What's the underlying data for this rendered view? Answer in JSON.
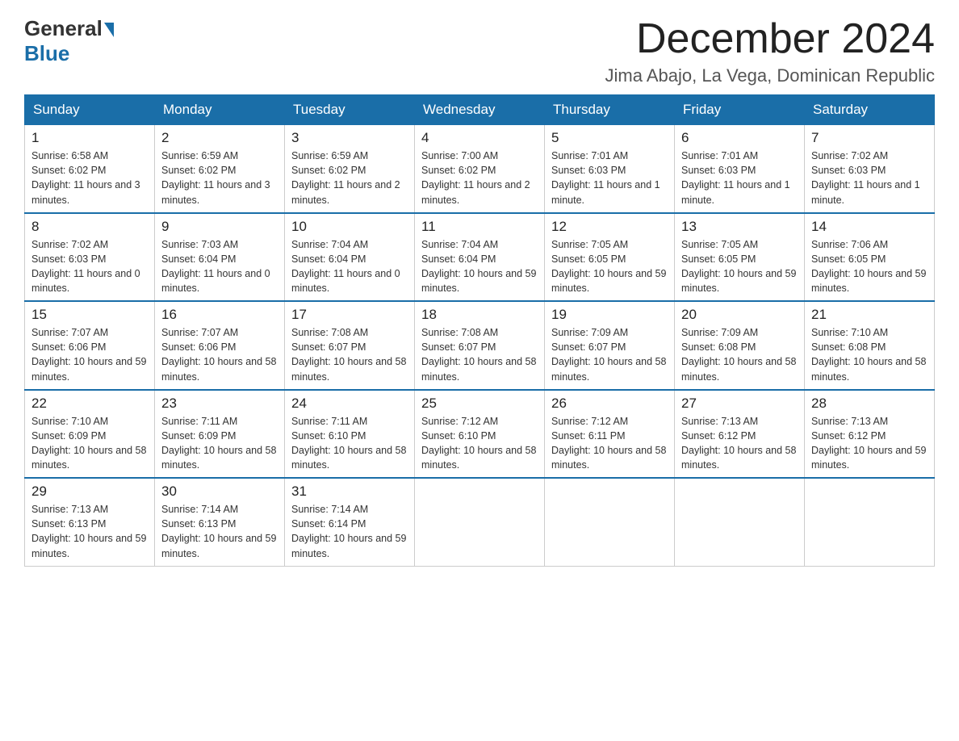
{
  "header": {
    "logo_general": "General",
    "logo_blue": "Blue",
    "month_title": "December 2024",
    "location": "Jima Abajo, La Vega, Dominican Republic"
  },
  "weekdays": [
    "Sunday",
    "Monday",
    "Tuesday",
    "Wednesday",
    "Thursday",
    "Friday",
    "Saturday"
  ],
  "weeks": [
    [
      {
        "day": "1",
        "sunrise": "6:58 AM",
        "sunset": "6:02 PM",
        "daylight": "11 hours and 3 minutes."
      },
      {
        "day": "2",
        "sunrise": "6:59 AM",
        "sunset": "6:02 PM",
        "daylight": "11 hours and 3 minutes."
      },
      {
        "day": "3",
        "sunrise": "6:59 AM",
        "sunset": "6:02 PM",
        "daylight": "11 hours and 2 minutes."
      },
      {
        "day": "4",
        "sunrise": "7:00 AM",
        "sunset": "6:02 PM",
        "daylight": "11 hours and 2 minutes."
      },
      {
        "day": "5",
        "sunrise": "7:01 AM",
        "sunset": "6:03 PM",
        "daylight": "11 hours and 1 minute."
      },
      {
        "day": "6",
        "sunrise": "7:01 AM",
        "sunset": "6:03 PM",
        "daylight": "11 hours and 1 minute."
      },
      {
        "day": "7",
        "sunrise": "7:02 AM",
        "sunset": "6:03 PM",
        "daylight": "11 hours and 1 minute."
      }
    ],
    [
      {
        "day": "8",
        "sunrise": "7:02 AM",
        "sunset": "6:03 PM",
        "daylight": "11 hours and 0 minutes."
      },
      {
        "day": "9",
        "sunrise": "7:03 AM",
        "sunset": "6:04 PM",
        "daylight": "11 hours and 0 minutes."
      },
      {
        "day": "10",
        "sunrise": "7:04 AM",
        "sunset": "6:04 PM",
        "daylight": "11 hours and 0 minutes."
      },
      {
        "day": "11",
        "sunrise": "7:04 AM",
        "sunset": "6:04 PM",
        "daylight": "10 hours and 59 minutes."
      },
      {
        "day": "12",
        "sunrise": "7:05 AM",
        "sunset": "6:05 PM",
        "daylight": "10 hours and 59 minutes."
      },
      {
        "day": "13",
        "sunrise": "7:05 AM",
        "sunset": "6:05 PM",
        "daylight": "10 hours and 59 minutes."
      },
      {
        "day": "14",
        "sunrise": "7:06 AM",
        "sunset": "6:05 PM",
        "daylight": "10 hours and 59 minutes."
      }
    ],
    [
      {
        "day": "15",
        "sunrise": "7:07 AM",
        "sunset": "6:06 PM",
        "daylight": "10 hours and 59 minutes."
      },
      {
        "day": "16",
        "sunrise": "7:07 AM",
        "sunset": "6:06 PM",
        "daylight": "10 hours and 58 minutes."
      },
      {
        "day": "17",
        "sunrise": "7:08 AM",
        "sunset": "6:07 PM",
        "daylight": "10 hours and 58 minutes."
      },
      {
        "day": "18",
        "sunrise": "7:08 AM",
        "sunset": "6:07 PM",
        "daylight": "10 hours and 58 minutes."
      },
      {
        "day": "19",
        "sunrise": "7:09 AM",
        "sunset": "6:07 PM",
        "daylight": "10 hours and 58 minutes."
      },
      {
        "day": "20",
        "sunrise": "7:09 AM",
        "sunset": "6:08 PM",
        "daylight": "10 hours and 58 minutes."
      },
      {
        "day": "21",
        "sunrise": "7:10 AM",
        "sunset": "6:08 PM",
        "daylight": "10 hours and 58 minutes."
      }
    ],
    [
      {
        "day": "22",
        "sunrise": "7:10 AM",
        "sunset": "6:09 PM",
        "daylight": "10 hours and 58 minutes."
      },
      {
        "day": "23",
        "sunrise": "7:11 AM",
        "sunset": "6:09 PM",
        "daylight": "10 hours and 58 minutes."
      },
      {
        "day": "24",
        "sunrise": "7:11 AM",
        "sunset": "6:10 PM",
        "daylight": "10 hours and 58 minutes."
      },
      {
        "day": "25",
        "sunrise": "7:12 AM",
        "sunset": "6:10 PM",
        "daylight": "10 hours and 58 minutes."
      },
      {
        "day": "26",
        "sunrise": "7:12 AM",
        "sunset": "6:11 PM",
        "daylight": "10 hours and 58 minutes."
      },
      {
        "day": "27",
        "sunrise": "7:13 AM",
        "sunset": "6:12 PM",
        "daylight": "10 hours and 58 minutes."
      },
      {
        "day": "28",
        "sunrise": "7:13 AM",
        "sunset": "6:12 PM",
        "daylight": "10 hours and 59 minutes."
      }
    ],
    [
      {
        "day": "29",
        "sunrise": "7:13 AM",
        "sunset": "6:13 PM",
        "daylight": "10 hours and 59 minutes."
      },
      {
        "day": "30",
        "sunrise": "7:14 AM",
        "sunset": "6:13 PM",
        "daylight": "10 hours and 59 minutes."
      },
      {
        "day": "31",
        "sunrise": "7:14 AM",
        "sunset": "6:14 PM",
        "daylight": "10 hours and 59 minutes."
      },
      null,
      null,
      null,
      null
    ]
  ]
}
